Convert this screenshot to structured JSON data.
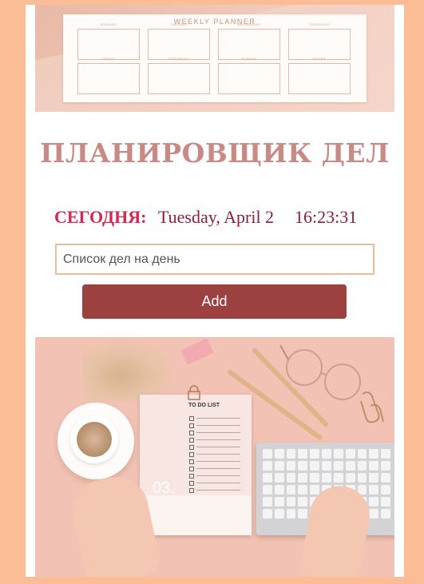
{
  "planner_image": {
    "title": "WEEKLY PLANNER",
    "days": [
      "MONDAY",
      "TUESDAY",
      "WEDNESDAY",
      "THURSDAY",
      "FRIDAY",
      "SATURDAY",
      "SUNDAY",
      "NOTES"
    ]
  },
  "header": {
    "title": "ПЛАНИРОВЩИК ДЕЛ"
  },
  "today": {
    "label": "СЕГОДНЯ:",
    "date": "Tuesday, April 2",
    "time": "16:23:31"
  },
  "task_form": {
    "placeholder": "Список дел на день",
    "value": "",
    "add_label": "Add"
  },
  "desk_image": {
    "notebook_title": "TO DO LIST",
    "notebook_number": "03."
  },
  "colors": {
    "page_background": "#fbbd95",
    "title": "#c98a85",
    "today_label": "#d8264f",
    "date_time": "#8e1e3a",
    "input_border": "#ebbd9e",
    "add_button": "#9c4140"
  }
}
